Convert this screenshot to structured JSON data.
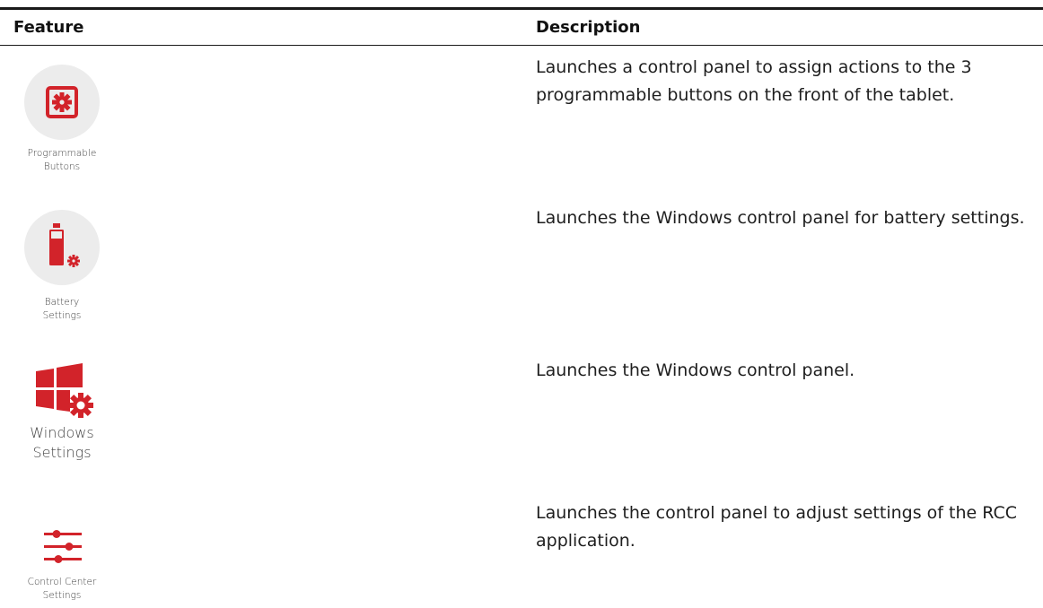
{
  "table": {
    "headers": {
      "feature": "Feature",
      "description": "Description"
    },
    "rows": [
      {
        "icon": "programmable-buttons-icon",
        "caption_line1": "Programmable",
        "caption_line2": "Buttons",
        "description": "Launches a control panel to assign actions to the 3 programmable buttons on the front of the tablet."
      },
      {
        "icon": "battery-settings-icon",
        "caption_line1": "Battery",
        "caption_line2": "Settings",
        "description": "Launches the Windows control panel for battery settings."
      },
      {
        "icon": "windows-settings-icon",
        "caption_line1": "Windows",
        "caption_line2": "Settings",
        "description": "Launches the Windows control panel."
      },
      {
        "icon": "control-center-settings-icon",
        "caption_line1": "Control Center",
        "caption_line2": "Settings",
        "description": "Launches the control panel to adjust settings of the RCC application."
      }
    ]
  },
  "colors": {
    "accent_red": "#d2232a",
    "tile_gray": "#ececec"
  }
}
